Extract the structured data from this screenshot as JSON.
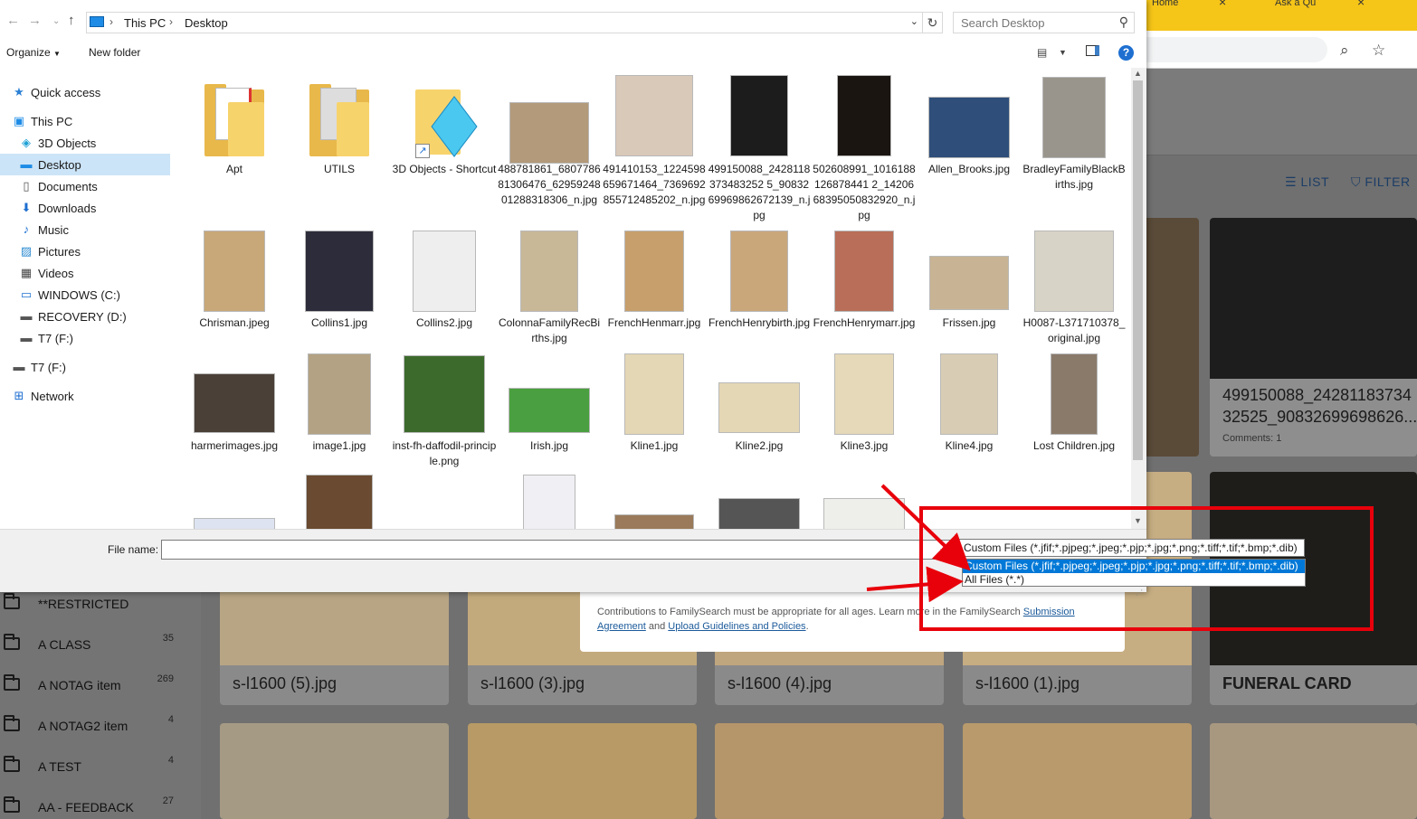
{
  "window": {
    "address": {
      "crumbs": [
        "This PC",
        "Desktop"
      ]
    },
    "search_placeholder": "Search Desktop",
    "toolbar": {
      "organize": "Organize",
      "new_folder": "New folder"
    }
  },
  "nav_pane": [
    {
      "label": "Quick access",
      "icon": "star-icon"
    },
    {
      "label": "This PC",
      "icon": "computer-icon"
    },
    {
      "label": "3D Objects",
      "icon": "cube-icon"
    },
    {
      "label": "Desktop",
      "icon": "desktop-icon",
      "selected": true
    },
    {
      "label": "Documents",
      "icon": "document-icon"
    },
    {
      "label": "Downloads",
      "icon": "download-icon"
    },
    {
      "label": "Music",
      "icon": "music-icon"
    },
    {
      "label": "Pictures",
      "icon": "pictures-icon"
    },
    {
      "label": "Videos",
      "icon": "video-icon"
    },
    {
      "label": "WINDOWS (C:)",
      "icon": "drive-icon"
    },
    {
      "label": "RECOVERY (D:)",
      "icon": "drive-icon"
    },
    {
      "label": "T7 (F:)",
      "icon": "drive-icon"
    },
    {
      "label": "T7 (F:)",
      "icon": "drive-icon"
    },
    {
      "label": "Network",
      "icon": "network-icon"
    }
  ],
  "files": [
    {
      "name": "Apt",
      "kind": "folder"
    },
    {
      "name": "UTILS",
      "kind": "folder"
    },
    {
      "name": "3D Objects - Shortcut",
      "kind": "shortcut"
    },
    {
      "name": "488781861_680778681306476_6295924801288318306_n.jpg",
      "kind": "image",
      "color": "#b39a7a"
    },
    {
      "name": "491410153_1224598659671464_7369692855712485202_n.jpg",
      "kind": "image",
      "color": "#d9c9b8"
    },
    {
      "name": "499150088_2428118373483252 5_9083269969862672139_n.jpg",
      "kind": "image",
      "color": "#1c1c1c"
    },
    {
      "name": "502608991_1016188126878441 2_1420668395050832920_n.jpg",
      "kind": "image",
      "color": "#1a1510"
    },
    {
      "name": "Allen_Brooks.jpg",
      "kind": "image",
      "color": "#2f4f7a"
    },
    {
      "name": "BradleyFamilyBlackBirths.jpg",
      "kind": "image",
      "color": "#9a958c"
    },
    {
      "name": "Chrisman.jpeg",
      "kind": "image",
      "color": "#c8a878"
    },
    {
      "name": "Collins1.jpg",
      "kind": "image",
      "color": "#2c2c3a"
    },
    {
      "name": "Collins2.jpg",
      "kind": "image",
      "color": "#eeeeee"
    },
    {
      "name": "ColonnaFamilyRecBirths.jpg",
      "kind": "image",
      "color": "#c8b898"
    },
    {
      "name": "FrenchHenmarr.jpg",
      "kind": "image",
      "color": "#c79f6c"
    },
    {
      "name": "FrenchHenrybirth.jpg",
      "kind": "image",
      "color": "#c9a77b"
    },
    {
      "name": "FrenchHenrymarr.jpg",
      "kind": "image",
      "color": "#b86e58"
    },
    {
      "name": "Frissen.jpg",
      "kind": "image",
      "color": "#c8b494"
    },
    {
      "name": "H0087-L371710378_original.jpg",
      "kind": "image",
      "color": "#d7d3c6"
    },
    {
      "name": "harmerimages.jpg",
      "kind": "image",
      "color": "#4a4038"
    },
    {
      "name": "image1.jpg",
      "kind": "image",
      "color": "#b3a283"
    },
    {
      "name": "inst-fh-daffodil-principle.png",
      "kind": "image",
      "color": "#3c6a2c"
    },
    {
      "name": "Irish.jpg",
      "kind": "image",
      "color": "#4aa040"
    },
    {
      "name": "Kline1.jpg",
      "kind": "image",
      "color": "#e4d7b5"
    },
    {
      "name": "Kline2.jpg",
      "kind": "image",
      "color": "#e4d7b5"
    },
    {
      "name": "Kline3.jpg",
      "kind": "image",
      "color": "#e6d9b9"
    },
    {
      "name": "Kline4.jpg",
      "kind": "image",
      "color": "#d8cdb4"
    },
    {
      "name": "Lost Children.jpg",
      "kind": "image",
      "color": "#8a7a6a"
    },
    {
      "name": "",
      "kind": "image",
      "color": "#dde3f0"
    },
    {
      "name": "",
      "kind": "image",
      "color": "#6a4a30"
    },
    {
      "name": "",
      "kind": "image",
      "color": "#f0f0f4"
    },
    {
      "name": "",
      "kind": "image",
      "color": "#9a7a5a"
    },
    {
      "name": "",
      "kind": "image",
      "color": "#555555"
    },
    {
      "name": "",
      "kind": "image",
      "color": "#eeeeea"
    }
  ],
  "bottom": {
    "file_name_label": "File name:",
    "file_name_value": "",
    "filter_selected": "Custom Files (*.jfif;*.pjpeg;*.jpeg;*.pjp;*.jpg;*.png;*.tiff;*.tif;*.bmp;*.dib)",
    "filter_options": [
      "Custom Files (*.jfif;*.pjpeg;*.jpeg;*.pjp;*.jpg;*.png;*.tiff;*.tif;*.bmp;*.dib)",
      "All Files (*.*)"
    ]
  },
  "background_page": {
    "tabs": [
      "Home",
      "Ask a Qu"
    ],
    "list_label": "LIST",
    "filter_label": "FILTER",
    "folders": [
      {
        "name": "**RESTRICTED",
        "count": ""
      },
      {
        "name": "A CLASS",
        "count": "35"
      },
      {
        "name": "A NOTAG item",
        "count": "269"
      },
      {
        "name": "A NOTAG2 item",
        "count": "4"
      },
      {
        "name": "A TEST",
        "count": "4"
      },
      {
        "name": "AA - FEEDBACK",
        "count": "27"
      }
    ],
    "featured_card": {
      "title": "499150088_24281183734",
      "title2": "32525_90832699698626...",
      "comments": "Comments: 1"
    },
    "cards": [
      "s-l1600 (5).jpg",
      "s-l1600 (3).jpg",
      "s-l1600 (4).jpg",
      "s-l1600 (1).jpg",
      "FUNERAL CARD"
    ],
    "notice": {
      "text": "Contributions to FamilySearch must be appropriate for all ages. Learn more in the FamilySearch",
      "link1": "Submission Agreement",
      "and": "and",
      "link2": "Upload Guidelines and Policies",
      "end": "."
    }
  },
  "colors": {
    "selection": "#cce4f7",
    "highlight": "#0078d7",
    "annotation": "#e8000b",
    "accent_tabbar": "#f5c518"
  }
}
